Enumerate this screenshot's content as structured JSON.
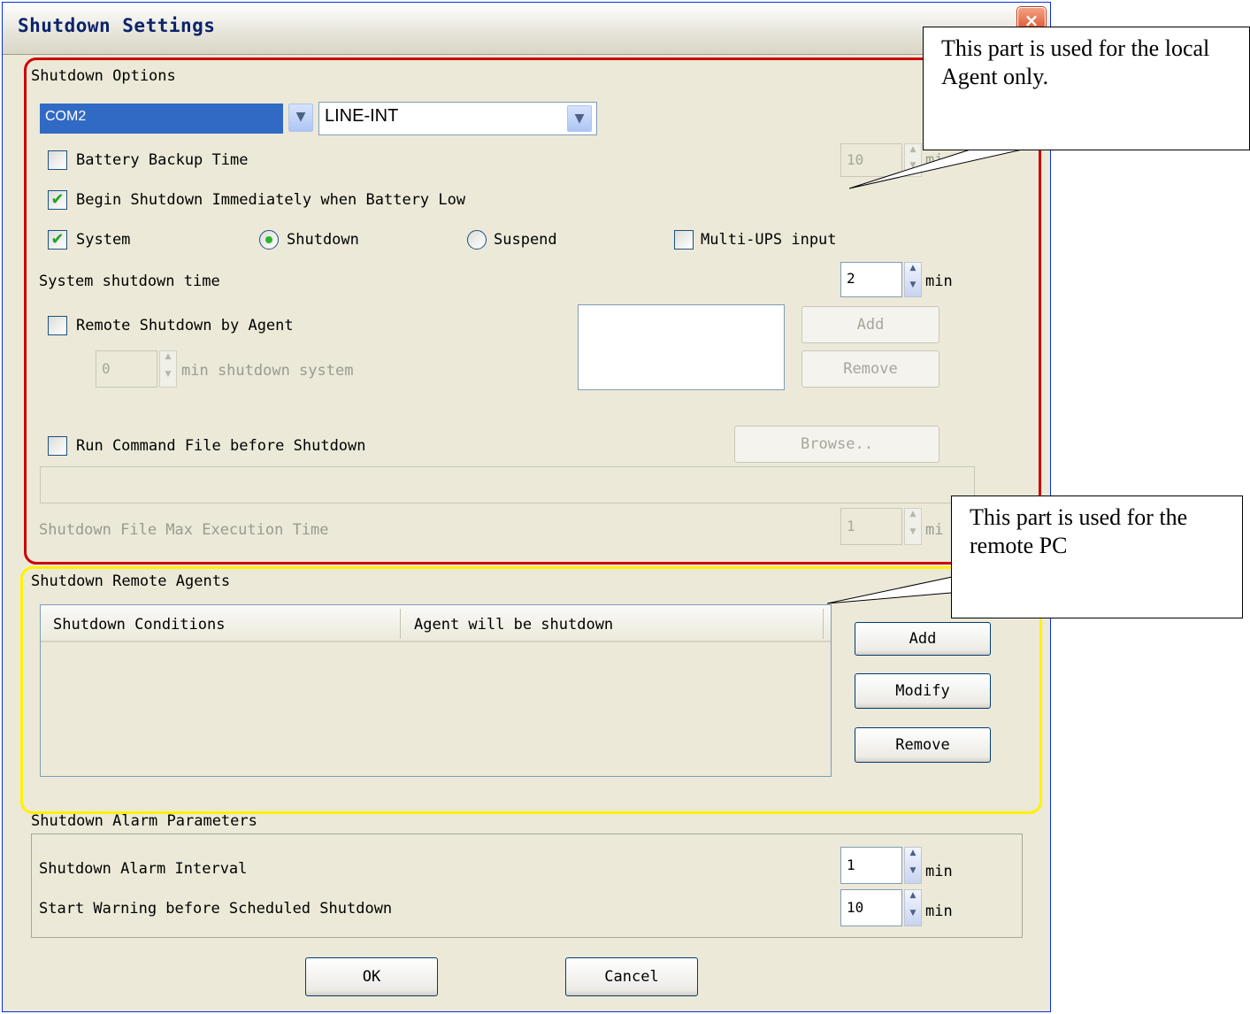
{
  "window": {
    "title": "Shutdown Settings",
    "close": "×"
  },
  "options": {
    "group": "Shutdown Options",
    "port": "COM2",
    "ups_type": "LINE-INT",
    "battery_backup": {
      "label": "Battery Backup Time",
      "checked": false,
      "value": "10",
      "unit": "mi"
    },
    "begin_shutdown": {
      "label": "Begin Shutdown Immediately when Battery Low",
      "checked": true
    },
    "system": {
      "label": "System",
      "checked": true
    },
    "radio_shutdown": {
      "label": "Shutdown",
      "selected": true
    },
    "radio_suspend": {
      "label": "Suspend",
      "selected": false
    },
    "multi_ups": {
      "label": "Multi-UPS input",
      "checked": false
    },
    "system_shutdown_time": {
      "label": "System shutdown time",
      "value": "2",
      "unit": "min"
    },
    "remote_shutdown": {
      "label": "Remote Shutdown by Agent",
      "checked": false,
      "value": "0",
      "suffix": "min shutdown system"
    },
    "add_label": "Add",
    "remove_label": "Remove",
    "run_command": {
      "label": "Run Command File before Shutdown",
      "checked": false
    },
    "browse_label": "Browse..",
    "command_path": "",
    "max_exec": {
      "label": "Shutdown File Max Execution Time",
      "value": "1",
      "unit": "mi"
    }
  },
  "remote_agents": {
    "group": "Shutdown Remote Agents",
    "columns": [
      "Shutdown Conditions",
      "Agent will be shutdown"
    ],
    "rows": [],
    "add_label": "Add",
    "modify_label": "Modify",
    "remove_label": "Remove"
  },
  "alarm": {
    "group": "Shutdown Alarm Parameters",
    "interval": {
      "label": "Shutdown Alarm Interval",
      "value": "1",
      "unit": "min"
    },
    "warning": {
      "label": "Start Warning before Scheduled Shutdown",
      "value": "10",
      "unit": "min"
    }
  },
  "footer": {
    "ok": "OK",
    "cancel": "Cancel"
  },
  "callouts": {
    "local": "This part is used for the local Agent only.",
    "remote": "This part is used for the remote PC"
  },
  "colors": {
    "highlight_red": "#CC0000",
    "highlight_yellow": "#FFF200",
    "selection": "#316AC5"
  }
}
